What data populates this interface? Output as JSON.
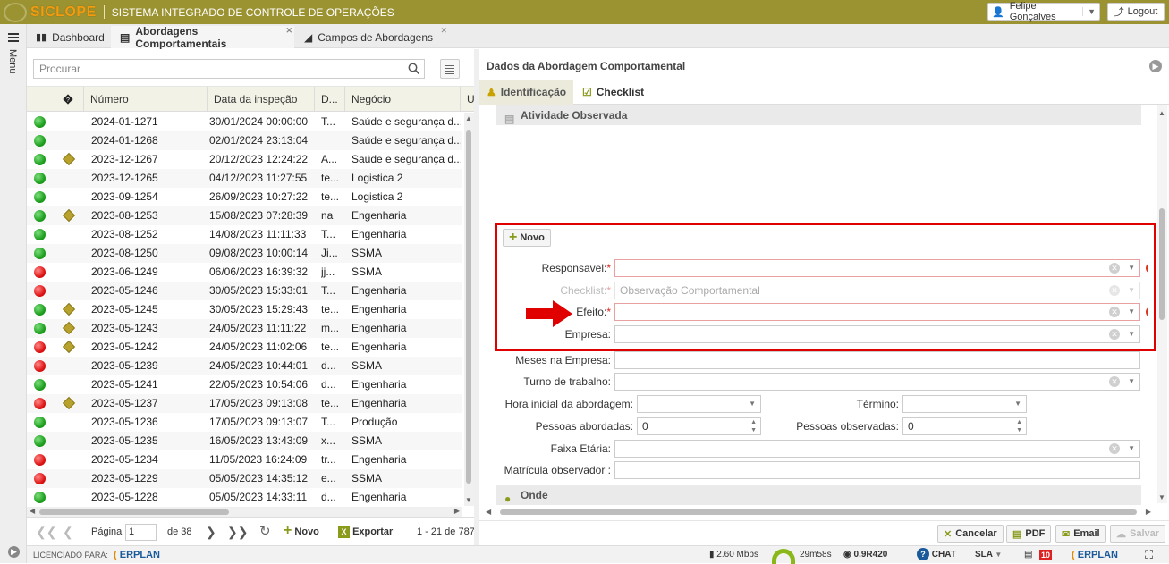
{
  "app": {
    "brand": "SICLOPE",
    "title": "SISTEMA INTEGRADO DE CONTROLE DE OPERAÇÕES",
    "user": "Felipe Gonçalves",
    "logout": "Logout",
    "menu": "Menu"
  },
  "tabs": [
    {
      "label": "Dashboard",
      "icon": "bar-chart-icon"
    },
    {
      "label": "Abordagens Comportamentais",
      "icon": "clipboard-icon"
    },
    {
      "label": "Campos de Abordagens",
      "icon": "chart-icon"
    }
  ],
  "list": {
    "search_placeholder": "Procurar",
    "columns": [
      "",
      "",
      "Número",
      "Data da inspeção",
      "D...",
      "Negócio",
      "U"
    ],
    "rows": [
      {
        "status": "green",
        "flag": false,
        "numero": "2024-01-1271",
        "data": "30/01/2024 00:00:00",
        "d": "T...",
        "negocio": "Saúde e segurança d..."
      },
      {
        "status": "green",
        "flag": false,
        "numero": "2024-01-1268",
        "data": "02/01/2024 23:13:04",
        "d": "",
        "negocio": "Saúde e segurança d..."
      },
      {
        "status": "green",
        "flag": true,
        "numero": "2023-12-1267",
        "data": "20/12/2023 12:24:22",
        "d": "A...",
        "negocio": "Saúde e segurança d..."
      },
      {
        "status": "green",
        "flag": false,
        "numero": "2023-12-1265",
        "data": "04/12/2023 11:27:55",
        "d": "te...",
        "negocio": "Logistica 2"
      },
      {
        "status": "green",
        "flag": false,
        "numero": "2023-09-1254",
        "data": "26/09/2023 10:27:22",
        "d": "te...",
        "negocio": "Logistica 2"
      },
      {
        "status": "green",
        "flag": true,
        "numero": "2023-08-1253",
        "data": "15/08/2023 07:28:39",
        "d": "na",
        "negocio": "Engenharia"
      },
      {
        "status": "green",
        "flag": false,
        "numero": "2023-08-1252",
        "data": "14/08/2023 11:11:33",
        "d": "T...",
        "negocio": "Engenharia"
      },
      {
        "status": "green",
        "flag": false,
        "numero": "2023-08-1250",
        "data": "09/08/2023 10:00:14",
        "d": "Ji...",
        "negocio": "SSMA"
      },
      {
        "status": "red",
        "flag": false,
        "numero": "2023-06-1249",
        "data": "06/06/2023 16:39:32",
        "d": "jj...",
        "negocio": "SSMA"
      },
      {
        "status": "red",
        "flag": false,
        "numero": "2023-05-1246",
        "data": "30/05/2023 15:33:01",
        "d": "T...",
        "negocio": "Engenharia"
      },
      {
        "status": "green",
        "flag": true,
        "numero": "2023-05-1245",
        "data": "30/05/2023 15:29:43",
        "d": "te...",
        "negocio": "Engenharia"
      },
      {
        "status": "green",
        "flag": true,
        "numero": "2023-05-1243",
        "data": "24/05/2023 11:11:22",
        "d": "m...",
        "negocio": "Engenharia"
      },
      {
        "status": "red",
        "flag": true,
        "numero": "2023-05-1242",
        "data": "24/05/2023 11:02:06",
        "d": "te...",
        "negocio": "Engenharia"
      },
      {
        "status": "red",
        "flag": false,
        "numero": "2023-05-1239",
        "data": "24/05/2023 10:44:01",
        "d": "d...",
        "negocio": "SSMA"
      },
      {
        "status": "green",
        "flag": false,
        "numero": "2023-05-1241",
        "data": "22/05/2023 10:54:06",
        "d": "d...",
        "negocio": "Engenharia"
      },
      {
        "status": "red",
        "flag": true,
        "numero": "2023-05-1237",
        "data": "17/05/2023 09:13:08",
        "d": "te...",
        "negocio": "Engenharia"
      },
      {
        "status": "green",
        "flag": false,
        "numero": "2023-05-1236",
        "data": "17/05/2023 09:13:07",
        "d": "T...",
        "negocio": "Produção"
      },
      {
        "status": "green",
        "flag": false,
        "numero": "2023-05-1235",
        "data": "16/05/2023 13:43:09",
        "d": "x...",
        "negocio": "SSMA"
      },
      {
        "status": "red",
        "flag": false,
        "numero": "2023-05-1234",
        "data": "11/05/2023 16:24:09",
        "d": "tr...",
        "negocio": "Engenharia"
      },
      {
        "status": "red",
        "flag": false,
        "numero": "2023-05-1229",
        "data": "05/05/2023 14:35:12",
        "d": "e...",
        "negocio": "SSMA"
      },
      {
        "status": "green",
        "flag": false,
        "numero": "2023-05-1228",
        "data": "05/05/2023 14:33:11",
        "d": "d...",
        "negocio": "Engenharia"
      }
    ],
    "pager": {
      "page_label": "Página",
      "page": "1",
      "of": "de 38",
      "novo": "Novo",
      "exportar": "Exportar",
      "range": "1 - 21 de 787"
    }
  },
  "detail": {
    "title": "Dados da Abordagem Comportamental",
    "tabs": [
      "Identificação",
      "Checklist"
    ],
    "section_atividade": "Atividade Observada",
    "novo": "Novo",
    "fields": {
      "responsavel": {
        "label": "Responsavel:",
        "value": ""
      },
      "checklist": {
        "label": "Checklist:",
        "value": "Observação Comportamental"
      },
      "efeito": {
        "label": "Efeito:",
        "value": ""
      },
      "empresa": {
        "label": "Empresa:",
        "value": ""
      },
      "meses": {
        "label": "Meses na Empresa:",
        "value": ""
      },
      "turno": {
        "label": "Turno de trabalho:",
        "value": ""
      },
      "hora_inicial": {
        "label": "Hora inicial da abordagem:",
        "value": ""
      },
      "termino": {
        "label": "Término:",
        "value": ""
      },
      "pessoas_abordadas": {
        "label": "Pessoas abordadas:",
        "value": "0"
      },
      "pessoas_observadas": {
        "label": "Pessoas observadas:",
        "value": "0"
      },
      "faixa": {
        "label": "Faixa Etária:",
        "value": ""
      },
      "matricula": {
        "label": "Matrícula observador :",
        "value": ""
      }
    },
    "section_onde": "Onde",
    "actions": {
      "cancelar": "Cancelar",
      "pdf": "PDF",
      "email": "Email",
      "salvar": "Salvar"
    }
  },
  "status": {
    "licensed": "LICENCIADO PARA:",
    "erplan": "ERPLAN",
    "speed": "2.60 Mbps",
    "timer": "29m58s",
    "version": "0.9R420",
    "chat": "CHAT",
    "sla": "SLA",
    "badge": "10"
  },
  "colors": {
    "topbar": "#9b9332",
    "brand": "#f39c12",
    "ok": "#1ea01e",
    "alert": "#e01515",
    "highlight": "#e00000"
  }
}
